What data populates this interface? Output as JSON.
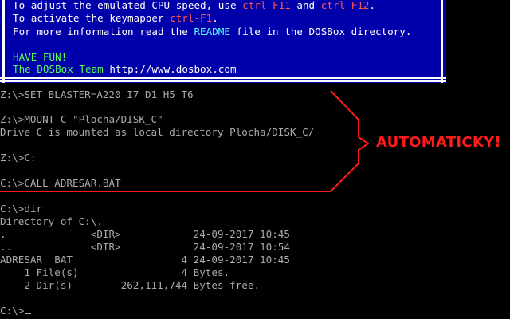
{
  "welcome_box": {
    "line1": {
      "a": "To adjust the emulated CPU speed, use ",
      "k1": "ctrl-F11",
      "b": " and ",
      "k2": "ctrl-F12",
      "c": "."
    },
    "line2": {
      "a": "To activate the keymapper ",
      "k1": "ctrl-F1",
      "b": "."
    },
    "line3": {
      "a": "For more information read the ",
      "k1": "README",
      "b": " file in the DOSBox directory."
    },
    "have_fun": "HAVE FUN!",
    "team_label": "The DOSBox Team ",
    "team_url": "http://www.dosbox.com"
  },
  "terminal": {
    "lines": [
      "Z:\\>SET BLASTER=A220 I7 D1 H5 T6",
      "",
      "Z:\\>MOUNT C \"Plocha/DISK_C\"",
      "Drive C is mounted as local directory Plocha/DISK_C/",
      "",
      "Z:\\>C:",
      "",
      "C:\\>CALL ADRESAR.BAT",
      "",
      "C:\\>dir",
      "Directory of C:\\.",
      ".              <DIR>            24-09-2017 10:45",
      "..             <DIR>            24-09-2017 10:54",
      "ADRESAR  BAT                  4 24-09-2017 10:45",
      "    1 File(s)                 4 Bytes.",
      "    2 Dir(s)        262,111,744 Bytes free.",
      ""
    ],
    "prompt": "C:\\>"
  },
  "annotation": {
    "label": "AUTOMATICKY!",
    "color": "#ff1a1a"
  },
  "colors": {
    "box_bg": "#0000aa",
    "text": "#aaaaaa",
    "highlight_red": "#ff5555",
    "highlight_cyan": "#55ffff",
    "highlight_green": "#55ff55"
  }
}
